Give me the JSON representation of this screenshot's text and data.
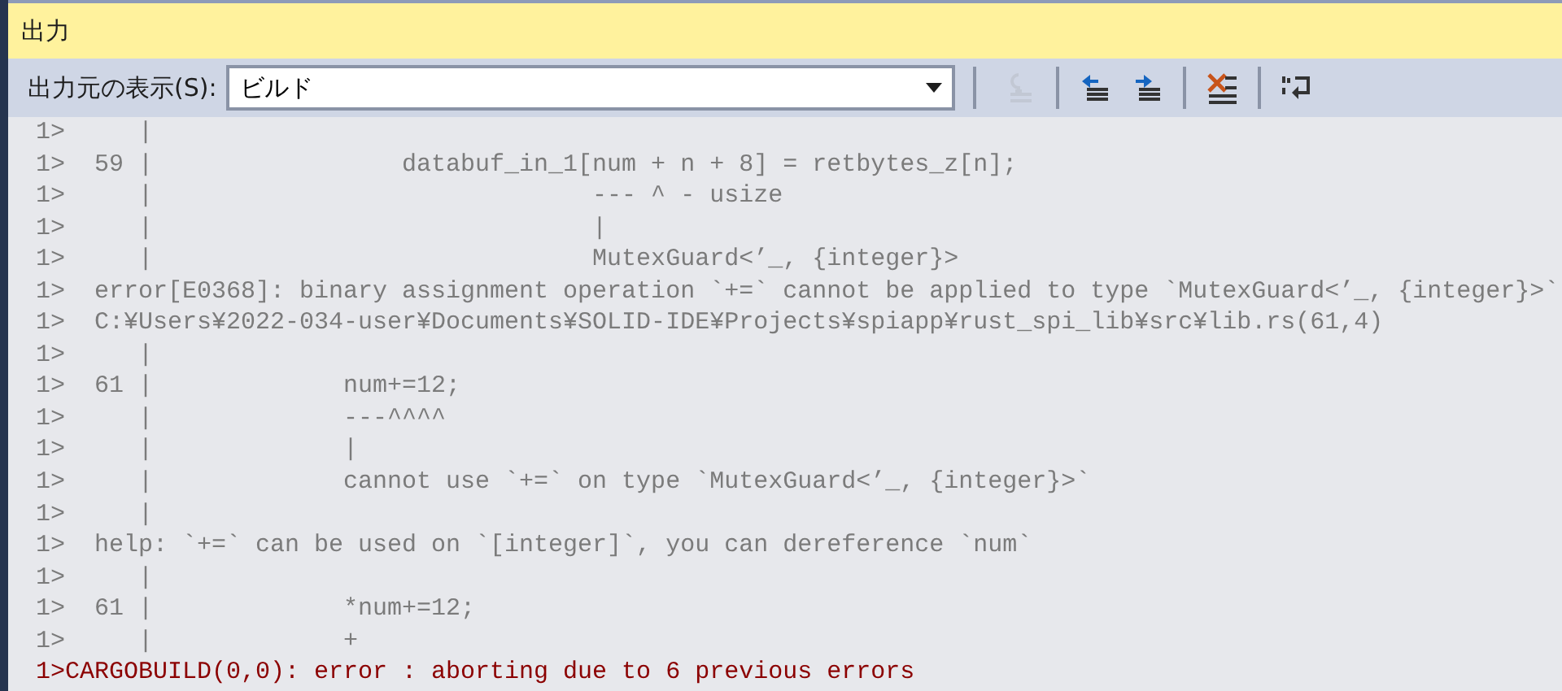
{
  "panel": {
    "title": "出力"
  },
  "toolbar": {
    "source_label": "出力元の表示(S):",
    "source_value": "ビルド",
    "buttons": [
      {
        "kind": "goto",
        "disabled": true
      },
      {
        "kind": "previous",
        "disabled": false
      },
      {
        "kind": "next",
        "disabled": false
      },
      {
        "kind": "clear",
        "disabled": false
      },
      {
        "kind": "wrap",
        "disabled": false
      }
    ]
  },
  "lines": [
    {
      "kind": "normal",
      "text": "1>     |"
    },
    {
      "kind": "normal",
      "text": "1>  59 |                 databuf_in_1[num + n + 8] = retbytes_z[n];"
    },
    {
      "kind": "normal",
      "text": "1>     |                              --- ^ - usize"
    },
    {
      "kind": "normal",
      "text": "1>     |                              |"
    },
    {
      "kind": "normal",
      "text": "1>     |                              MutexGuard<’_, {integer}>"
    },
    {
      "kind": "normal",
      "text": "1>  error[E0368]: binary assignment operation `+=` cannot be applied to type `MutexGuard<’_, {integer}>`"
    },
    {
      "kind": "normal",
      "text": "1>  C:¥Users¥2022-034-user¥Documents¥SOLID-IDE¥Projects¥spiapp¥rust_spi_lib¥src¥lib.rs(61,4)"
    },
    {
      "kind": "normal",
      "text": "1>     |"
    },
    {
      "kind": "normal",
      "text": "1>  61 |             num+=12;"
    },
    {
      "kind": "normal",
      "text": "1>     |             ---^^^^"
    },
    {
      "kind": "normal",
      "text": "1>     |             |"
    },
    {
      "kind": "normal",
      "text": "1>     |             cannot use `+=` on type `MutexGuard<’_, {integer}>`"
    },
    {
      "kind": "normal",
      "text": "1>     |"
    },
    {
      "kind": "normal",
      "text": "1>  help: `+=` can be used on `[integer]`, you can dereference `num`"
    },
    {
      "kind": "normal",
      "text": "1>     |"
    },
    {
      "kind": "normal",
      "text": "1>  61 |             *num+=12;"
    },
    {
      "kind": "normal",
      "text": "1>     |             +"
    },
    {
      "kind": "error",
      "text": "1>CARGOBUILD(0,0): error : aborting due to 6 previous errors"
    }
  ]
}
